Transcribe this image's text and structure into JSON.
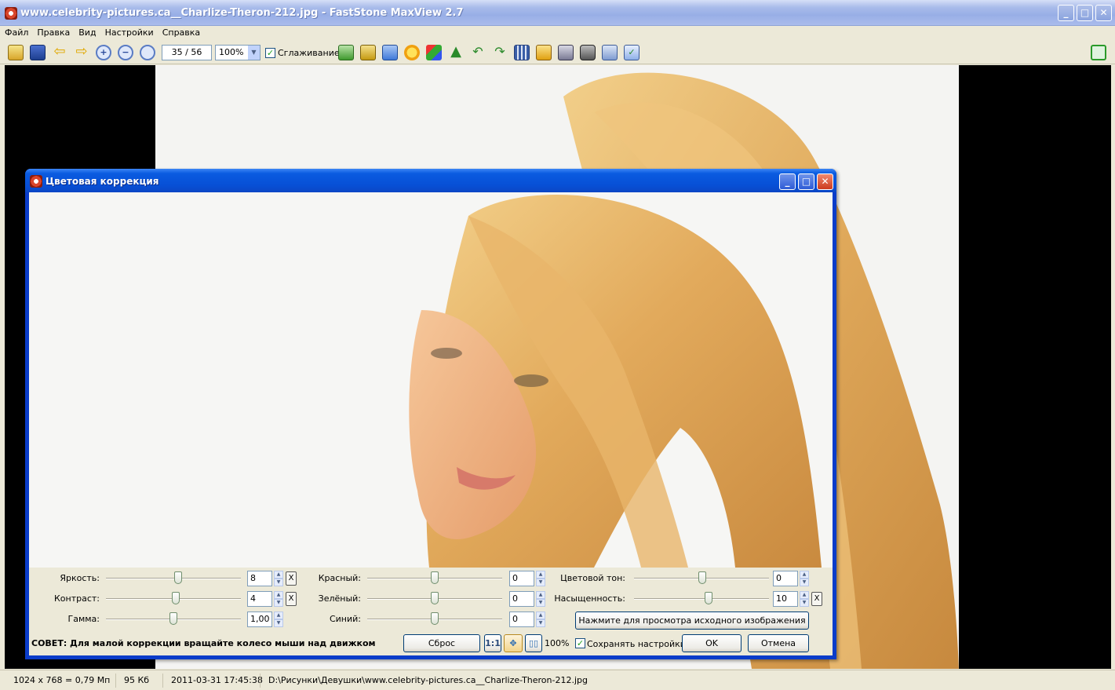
{
  "window": {
    "title": "www.celebrity-pictures.ca__Charlize-Theron-212.jpg - FastStone MaxView 2.7"
  },
  "menu": [
    "Файл",
    "Правка",
    "Вид",
    "Настройки",
    "Справка"
  ],
  "toolbar": {
    "page_counter": "35 / 56",
    "zoom": "100%",
    "smoothing_label": "Сглаживание",
    "smoothing_checked": true
  },
  "dialog": {
    "title": "Цветовая коррекция",
    "brightness": {
      "label": "Яркость:",
      "value": "8"
    },
    "contrast": {
      "label": "Контраст:",
      "value": "4"
    },
    "gamma": {
      "label": "Гамма:",
      "value": "1,00"
    },
    "red": {
      "label": "Красный:",
      "value": "0"
    },
    "green": {
      "label": "Зелёный:",
      "value": "0"
    },
    "blue": {
      "label": "Синий:",
      "value": "0"
    },
    "hue": {
      "label": "Цветовой тон:",
      "value": "0"
    },
    "saturation": {
      "label": "Насыщенность:",
      "value": "10"
    },
    "reset_x": "X",
    "view_original_button": "Нажмите для просмотра исходного изображения",
    "tip": "СОВЕТ: Для малой коррекции вращайте колесо мыши над движком",
    "reset_button": "Сброс",
    "zoom_1to1": "1:1",
    "zoom_percent": "100%",
    "save_settings_label": "Сохранять настройки",
    "save_settings_checked": true,
    "ok_button": "OK",
    "cancel_button": "Отмена"
  },
  "status": {
    "dimensions": "1024 x 768 = 0,79 Мп",
    "filesize": "95 Кб",
    "datetime": "2011-03-31 17:45:38",
    "path": "D:\\Рисунки\\Девушки\\www.celebrity-pictures.ca__Charlize-Theron-212.jpg"
  }
}
